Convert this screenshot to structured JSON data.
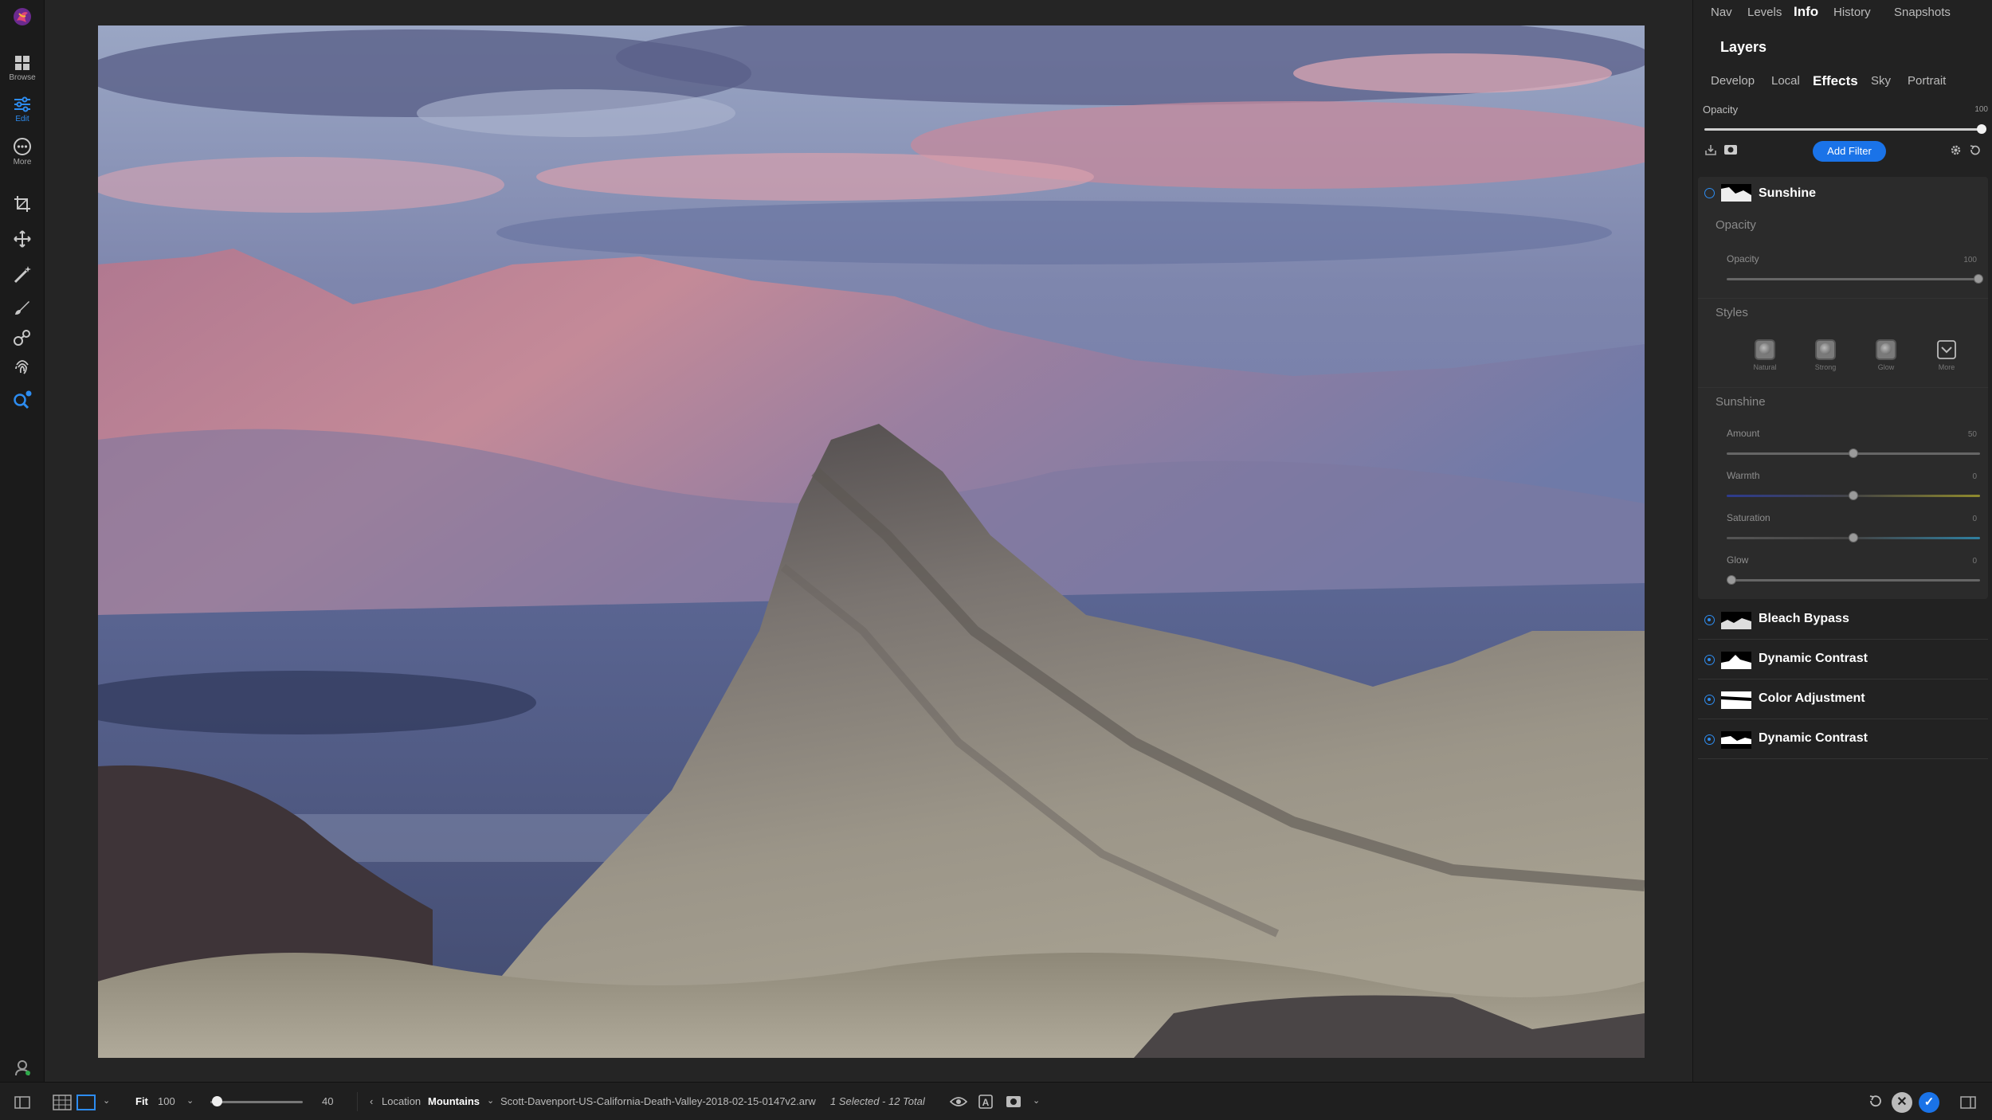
{
  "left_toolbar": {
    "items": [
      {
        "icon": "browse-grid-icon",
        "label": "Browse"
      },
      {
        "icon": "edit-sliders-icon",
        "label": "Edit"
      },
      {
        "icon": "more-dots-icon",
        "label": "More"
      }
    ],
    "tools": [
      "crop-icon",
      "transform-move-icon",
      "magic-brush-icon",
      "local-brush-icon",
      "clone-icon",
      "fingerprint-retouch-icon",
      "search-ai-icon"
    ]
  },
  "panel": {
    "top_tabs": [
      "Nav",
      "Levels",
      "Info",
      "History",
      "Snapshots"
    ],
    "selected_top_tab": "Info",
    "title": "Layers",
    "sub_tabs": [
      "Develop",
      "Local",
      "Effects",
      "Sky",
      "Portrait"
    ],
    "selected_sub_tab": "Effects",
    "opacity_label": "Opacity",
    "opacity_value": "100",
    "add_filter_label": "Add Filter",
    "expanded_filter": {
      "name": "Sunshine",
      "opacity_section": "Opacity",
      "opacity_label": "Opacity",
      "opacity_value": "100",
      "styles_section": "Styles",
      "styles": [
        "Natural",
        "Strong",
        "Glow",
        "More"
      ],
      "params_section": "Sunshine",
      "params": [
        {
          "label": "Amount",
          "value": "50",
          "level": 0.5
        },
        {
          "label": "Warmth",
          "value": "0",
          "level": 0.5
        },
        {
          "label": "Saturation",
          "value": "0",
          "level": 0.5
        },
        {
          "label": "Glow",
          "value": "0",
          "level": 0.0
        }
      ]
    },
    "filters": [
      "Bleach Bypass",
      "Dynamic Contrast",
      "Color Adjustment",
      "Dynamic Contrast"
    ]
  },
  "bottom_bar": {
    "fit_label": "Fit",
    "zoom_value": "100",
    "thumb_size": "40",
    "thumb_level": 0.02,
    "location_label": "Location",
    "folder": "Mountains",
    "filename": "Scott-Davenport-US-California-Death-Valley-2018-02-15-0147v2.arw",
    "selection_status": "1 Selected - 12 Total"
  },
  "colors": {
    "accent": "#1a73e8",
    "panel_bg": "#222222",
    "toolbar_bg": "#1b1b1b"
  }
}
